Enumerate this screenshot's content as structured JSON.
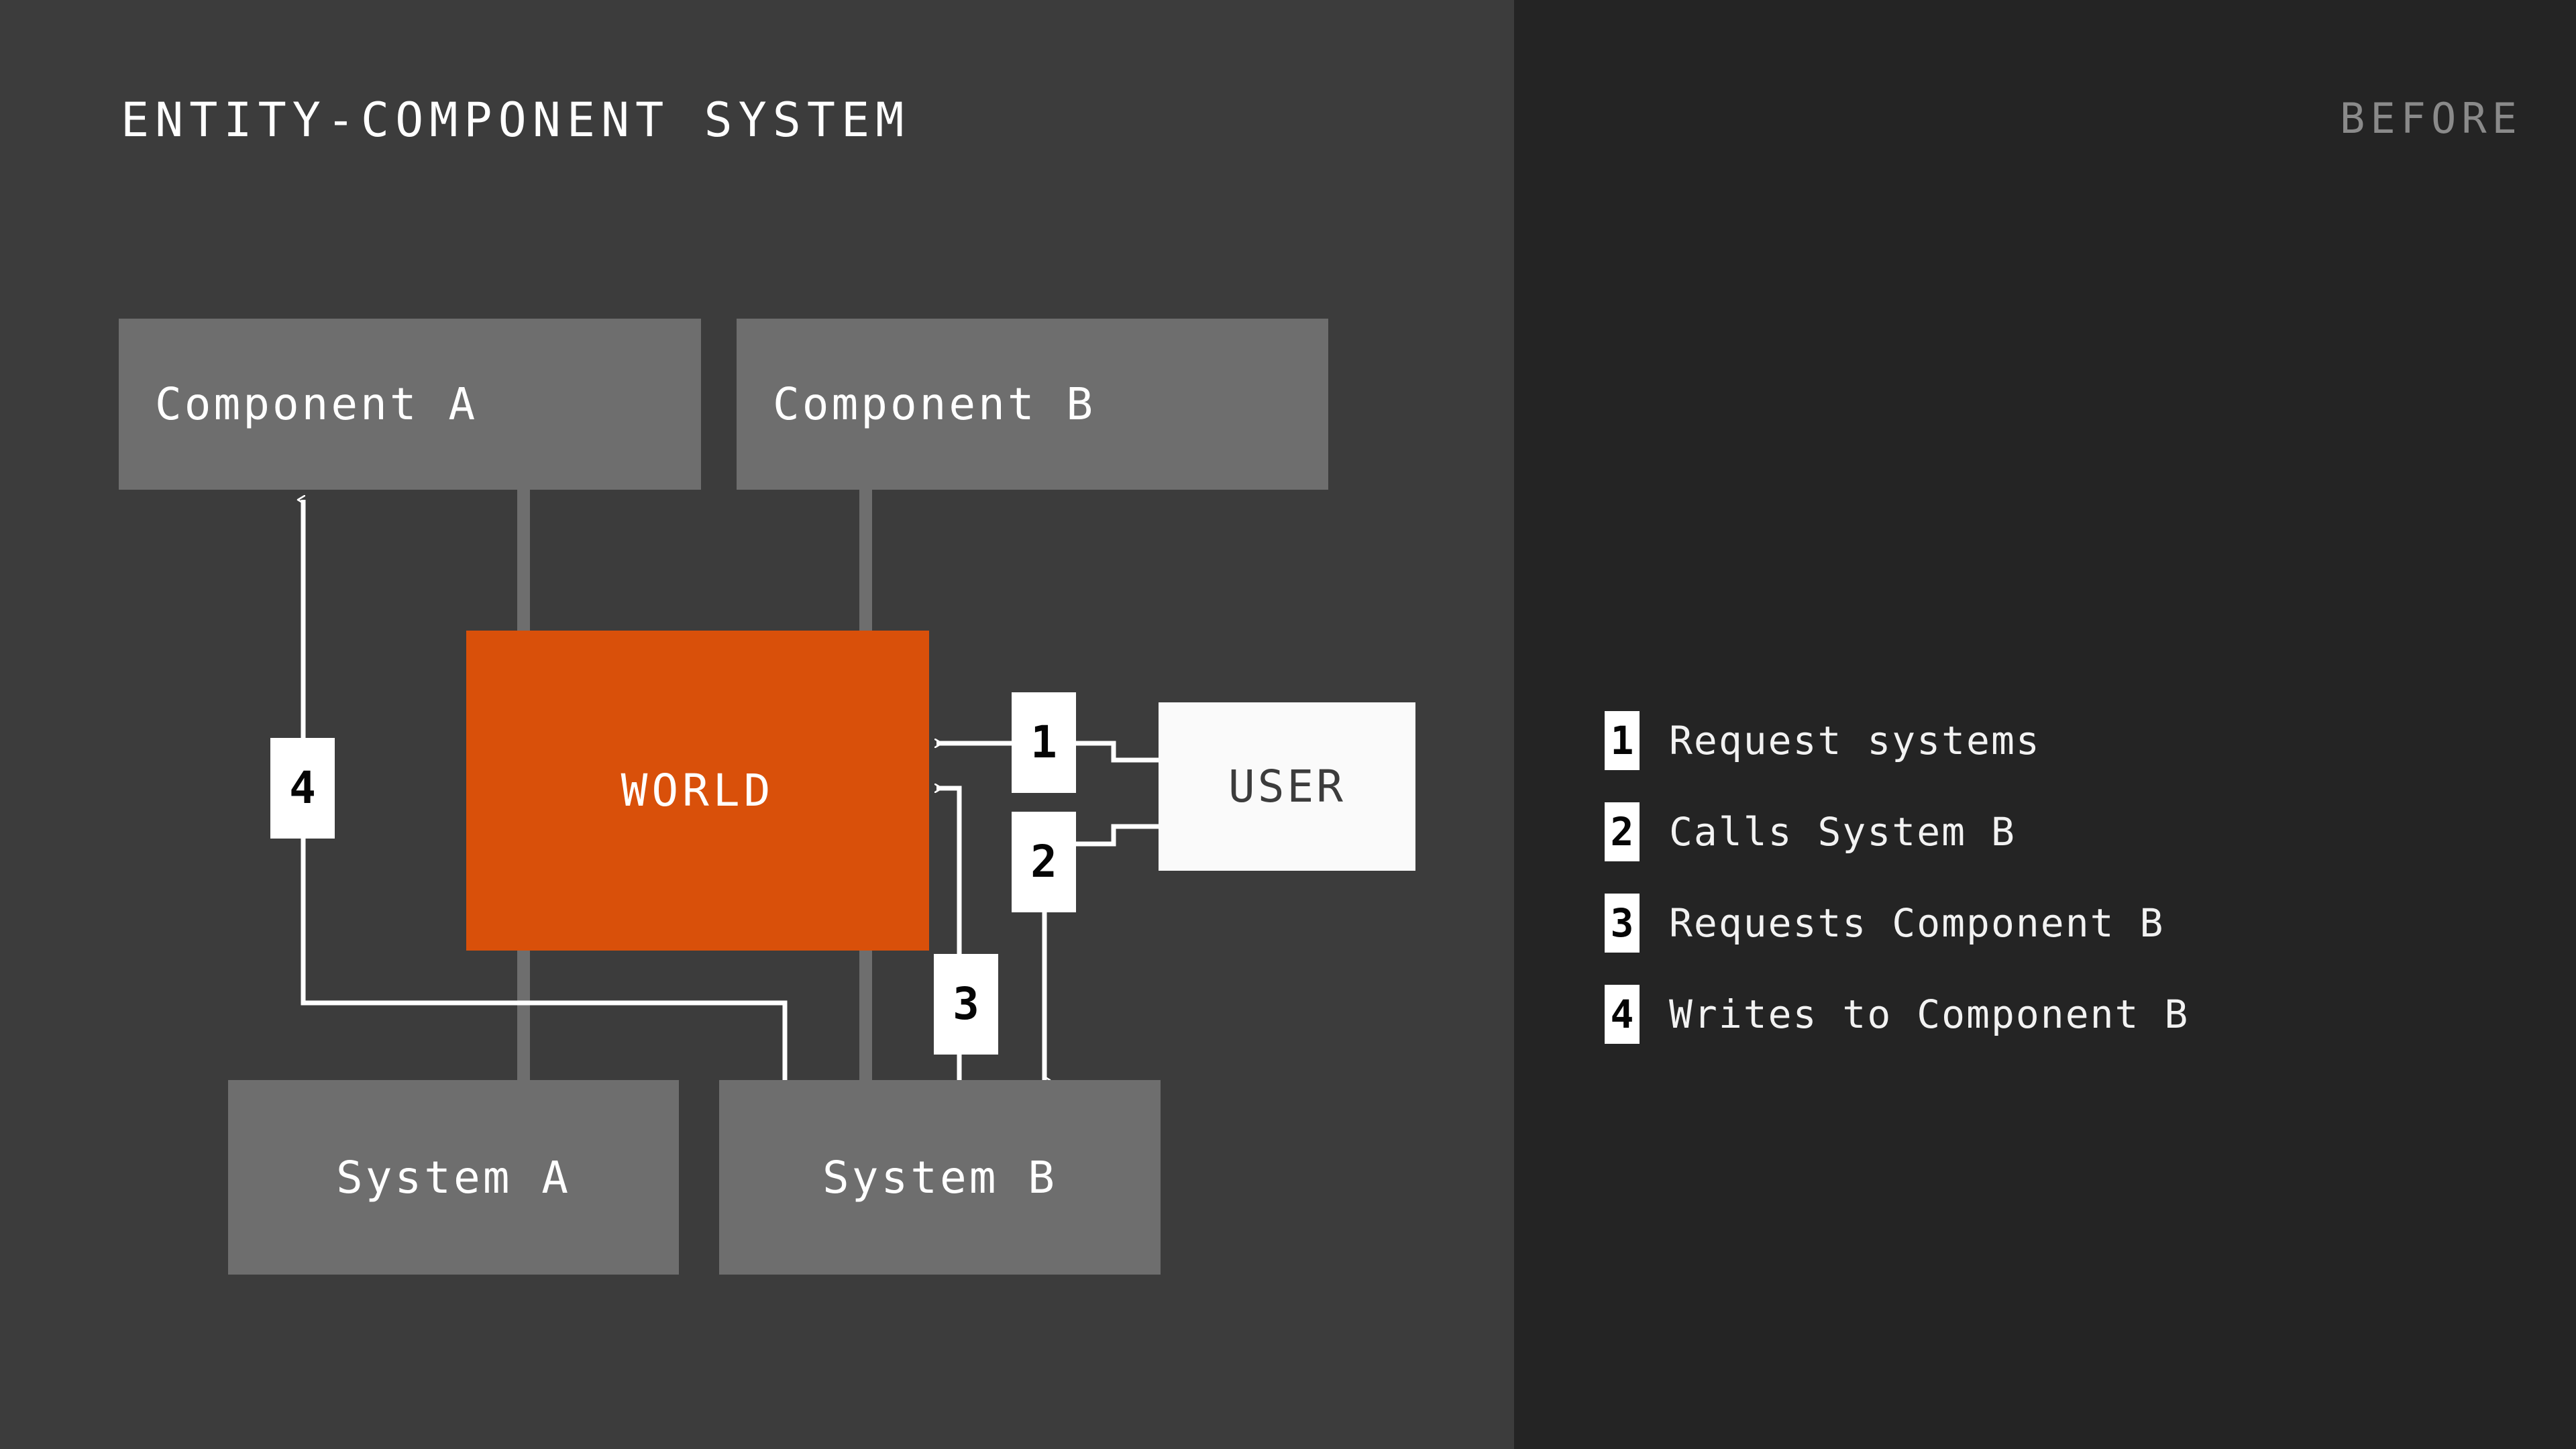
{
  "header": {
    "title": "ENTITY-COMPONENT SYSTEM",
    "stage_label": "BEFORE"
  },
  "colors": {
    "panel_left_bg": "#3C3C3C",
    "panel_right_bg": "#242424",
    "node_gray": "#6E6E6E",
    "world_orange": "#D9500A",
    "user_white": "#FAFAFA",
    "line_white": "#FFFFFF",
    "pipe_gray": "#6E6E6E",
    "text_white": "#FFFFFF",
    "label_gray": "#8A8A8A"
  },
  "diagram": {
    "nodes": [
      {
        "id": "component-a",
        "label": "Component A",
        "kind": "component"
      },
      {
        "id": "component-b",
        "label": "Component B",
        "kind": "component"
      },
      {
        "id": "world",
        "label": "WORLD",
        "kind": "world"
      },
      {
        "id": "user",
        "label": "USER",
        "kind": "actor"
      },
      {
        "id": "system-a",
        "label": "System A",
        "kind": "system"
      },
      {
        "id": "system-b",
        "label": "System B",
        "kind": "system"
      }
    ],
    "badges": [
      {
        "id": "badge-1",
        "number": "1"
      },
      {
        "id": "badge-2",
        "number": "2"
      },
      {
        "id": "badge-3",
        "number": "3"
      },
      {
        "id": "badge-4",
        "number": "4"
      }
    ],
    "edges": [
      {
        "id": "edge-1",
        "from": "user",
        "to": "world",
        "badge": "1"
      },
      {
        "id": "edge-2",
        "from": "user",
        "to": "system-b",
        "badge": "2"
      },
      {
        "id": "edge-3",
        "from": "system-b",
        "to": "world",
        "badge": "3"
      },
      {
        "id": "edge-4",
        "from": "system-b",
        "to": "component-a",
        "badge": "4"
      }
    ]
  },
  "legend": {
    "items": [
      {
        "number": "1",
        "text": "Request systems"
      },
      {
        "number": "2",
        "text": "Calls System B"
      },
      {
        "number": "3",
        "text": "Requests Component B"
      },
      {
        "number": "4",
        "text": "Writes to Component B"
      }
    ]
  }
}
